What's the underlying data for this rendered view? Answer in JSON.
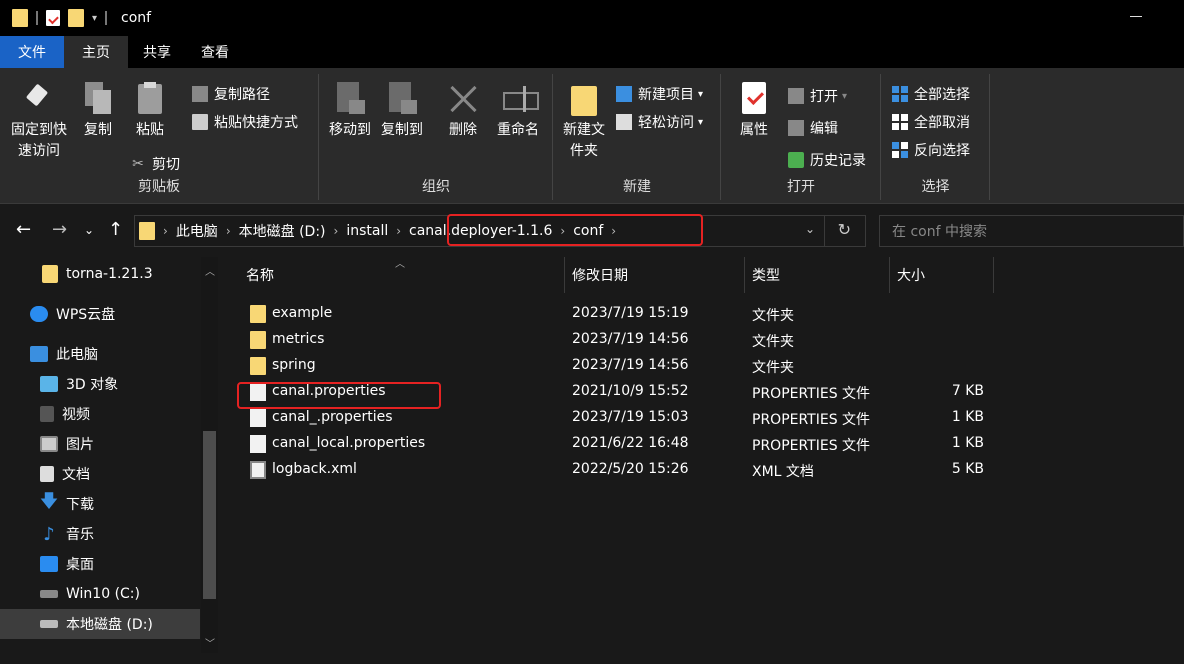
{
  "window": {
    "title": "conf"
  },
  "tabs": [
    "文件",
    "主页",
    "共享",
    "查看"
  ],
  "ribbon": {
    "clipboard": {
      "pin": "固定到快速访问",
      "copy": "复制",
      "paste": "粘贴",
      "copy_path": "复制路径",
      "paste_shortcut": "粘贴快捷方式",
      "cut": "剪切",
      "label": "剪贴板"
    },
    "organize": {
      "move_to": "移动到",
      "copy_to": "复制到",
      "delete": "删除",
      "rename": "重命名",
      "label": "组织"
    },
    "new": {
      "new_folder": "新建文件夹",
      "new_item": "新建项目",
      "easy_access": "轻松访问",
      "label": "新建"
    },
    "open": {
      "properties": "属性",
      "open": "打开",
      "edit": "编辑",
      "history": "历史记录",
      "label": "打开"
    },
    "select": {
      "select_all": "全部选择",
      "select_none": "全部取消",
      "invert": "反向选择",
      "label": "选择"
    }
  },
  "address": {
    "segments": [
      "此电脑",
      "本地磁盘 (D:)",
      "install",
      "canal.deployer-1.1.6",
      "conf"
    ],
    "search_placeholder": "在 conf 中搜索"
  },
  "sidebar": [
    {
      "label": "torna-1.21.3",
      "icon": "folder-icon",
      "selected": false
    },
    {
      "label": "WPS云盘",
      "icon": "cloud-icon",
      "selected": false
    },
    {
      "label": "此电脑",
      "icon": "computer-icon",
      "selected": false
    },
    {
      "label": "3D 对象",
      "icon": "cube-icon",
      "selected": false
    },
    {
      "label": "视频",
      "icon": "video-icon",
      "selected": false
    },
    {
      "label": "图片",
      "icon": "picture-icon",
      "selected": false
    },
    {
      "label": "文档",
      "icon": "document-icon",
      "selected": false
    },
    {
      "label": "下载",
      "icon": "download-icon",
      "selected": false
    },
    {
      "label": "音乐",
      "icon": "music-icon",
      "selected": false
    },
    {
      "label": "桌面",
      "icon": "desktop-icon",
      "selected": false
    },
    {
      "label": "Win10 (C:)",
      "icon": "drive-icon",
      "selected": false
    },
    {
      "label": "本地磁盘 (D:)",
      "icon": "drive-icon",
      "selected": true
    }
  ],
  "columns": {
    "name": "名称",
    "date": "修改日期",
    "type": "类型",
    "size": "大小"
  },
  "files": [
    {
      "name": "example",
      "date": "2023/7/19 15:19",
      "type": "文件夹",
      "size": "",
      "kind": "folder"
    },
    {
      "name": "metrics",
      "date": "2023/7/19 14:56",
      "type": "文件夹",
      "size": "",
      "kind": "folder"
    },
    {
      "name": "spring",
      "date": "2023/7/19 14:56",
      "type": "文件夹",
      "size": "",
      "kind": "folder"
    },
    {
      "name": "canal.properties",
      "date": "2021/10/9 15:52",
      "type": "PROPERTIES 文件",
      "size": "7 KB",
      "kind": "doc"
    },
    {
      "name": "canal_.properties",
      "date": "2023/7/19 15:03",
      "type": "PROPERTIES 文件",
      "size": "1 KB",
      "kind": "doc"
    },
    {
      "name": "canal_local.properties",
      "date": "2021/6/22 16:48",
      "type": "PROPERTIES 文件",
      "size": "1 KB",
      "kind": "doc"
    },
    {
      "name": "logback.xml",
      "date": "2022/5/20 15:26",
      "type": "XML 文档",
      "size": "5 KB",
      "kind": "xml"
    }
  ],
  "colors": {
    "highlight": "#e52222",
    "file_tab": "#1a63c6",
    "folder": "#f8d775"
  }
}
